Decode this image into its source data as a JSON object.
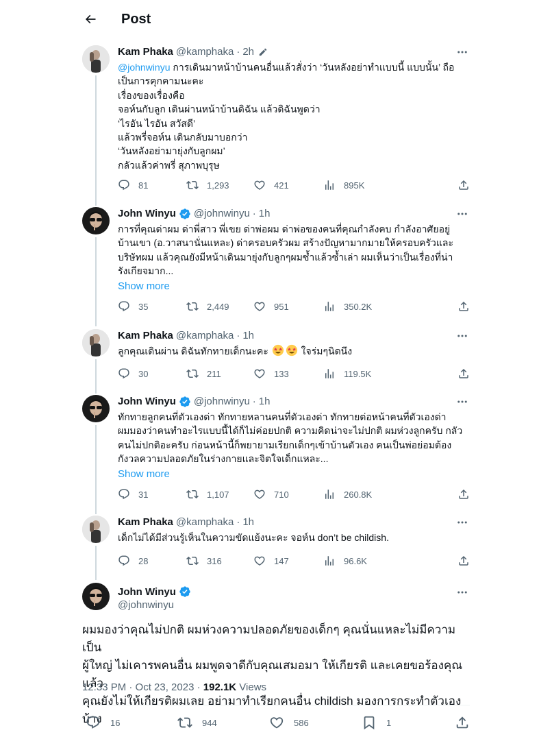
{
  "header": {
    "title": "Post"
  },
  "replies": [
    {
      "name": "Kam Phaka",
      "handle": "@kamphaka",
      "time": "2h",
      "mention": "@johnwinyu",
      "text_first": " การเดินมาหน้าบ้านคนอื่นแล้วสั่งว่า ‘วันหลังอย่าทำแบบนี้ แบบนั้น’ ถือ",
      "text_rest": "เป็นการคุกคามนะคะ\nเรื่องของเรื่องคือ\nจอห์นกับลูก เดินผ่านหน้าบ้านดิฉัน แล้วดิฉันพูดว่า\n‘ไรอัน ไรอัน สวัสดี’\nแล้วพรี่จอห์น เดินกลับมาบอกว่า\n‘วันหลังอย่ามายุ่งกับลูกผม’\nกลัวแล้วค่าพรี่ สุภาพบุรุษ",
      "stats": {
        "replies": "81",
        "reposts": "1,293",
        "likes": "421",
        "views": "895K"
      }
    },
    {
      "name": "John Winyu",
      "handle": "@johnwinyu",
      "time": "1h",
      "text": "การที่คุณด่าผม ด่าพี่สาว พี่เขย ด่าพ่อผม ด่าพ่อของคนที่คุณกำลังคบ กำลังอาศัยอยู่\nบ้านเขา (อ.วาสนานั่นแหละ) ด่าครอบครัวผม สร้างปัญหามากมายให้ครอบครัวและ\nบริษัทผม แล้วคุณยังมีหน้าเดินมายุ่งกับลูกๆผมซ้ำแล้วซ้ำเล่า ผมเห็นว่าเป็นเรื่องที่น่า\nรังเกียจมาก...",
      "show_more": "Show more",
      "stats": {
        "replies": "35",
        "reposts": "2,449",
        "likes": "951",
        "views": "350.2K"
      }
    },
    {
      "name": "Kam Phaka",
      "handle": "@kamphaka",
      "time": "1h",
      "text_before": "ลูกคุณเดินผ่าน ดิฉันทักทายเด็กนะคะ ",
      "text_after": " ใจร่มๆนิดนึง",
      "stats": {
        "replies": "30",
        "reposts": "211",
        "likes": "133",
        "views": "119.5K"
      }
    },
    {
      "name": "John Winyu",
      "handle": "@johnwinyu",
      "time": "1h",
      "text": "ทักทายลูกคนที่ตัวเองด่า ทักทายหลานคนที่ตัวเองด่า ทักทายต่อหน้าคนที่ตัวเองด่า\nผมมองว่าคนทำอะไรแบบนี้ได้ก็ไม่ค่อยปกติ ความคิดน่าจะไม่ปกติ ผมห่วงลูกครับ กลัว\nคนไม่ปกติอะครับ ก่อนหน้านี้ก็พยายามเรียกเด็กๆเข้าบ้านตัวเอง คนเป็นพ่อย่อมต้อง\nกังวลความปลอดภัยในร่างกายและจิตใจเด็กแหละ...",
      "show_more": "Show more",
      "stats": {
        "replies": "31",
        "reposts": "1,107",
        "likes": "710",
        "views": "260.8K"
      }
    },
    {
      "name": "Kam Phaka",
      "handle": "@kamphaka",
      "time": "1h",
      "text": "เด็กไม่ได้มีส่วนรู้เห็นในความขัดแย้งนะคะ จอห์น don’t be childish.",
      "stats": {
        "replies": "28",
        "reposts": "316",
        "likes": "147",
        "views": "96.6K"
      }
    }
  ],
  "main": {
    "name": "John Winyu",
    "handle": "@johnwinyu",
    "text_lines": [
      "ผมมองว่าคุณไม่ปกติ ผมห่วงความปลอดภัยของเด็กๆ คุณนั่นแหละไม่มีความเป็น",
      "ผู้ใหญ่ ไม่เคารพคนอื่น ผมพูดจาดีกับคุณเสมอมา ให้เกียรติ และเคยขอร้องคุณแล้ว",
      "คุณยังไม่ให้เกียรติผมเลย อย่ามาทำเรียกคนอื่น childish มองการกระทำตัวเองบ้าง"
    ],
    "timestamp": "12:33 PM · Oct 23, 2023 · ",
    "views_count": "192.1K",
    "views_label": " Views",
    "stats": {
      "replies": "16",
      "reposts": "944",
      "likes": "586",
      "bookmarks": "1"
    }
  },
  "colors": {
    "accent": "#1d9bf0",
    "secondary": "#536471",
    "text": "#0f1419",
    "line": "#cfd9de"
  }
}
